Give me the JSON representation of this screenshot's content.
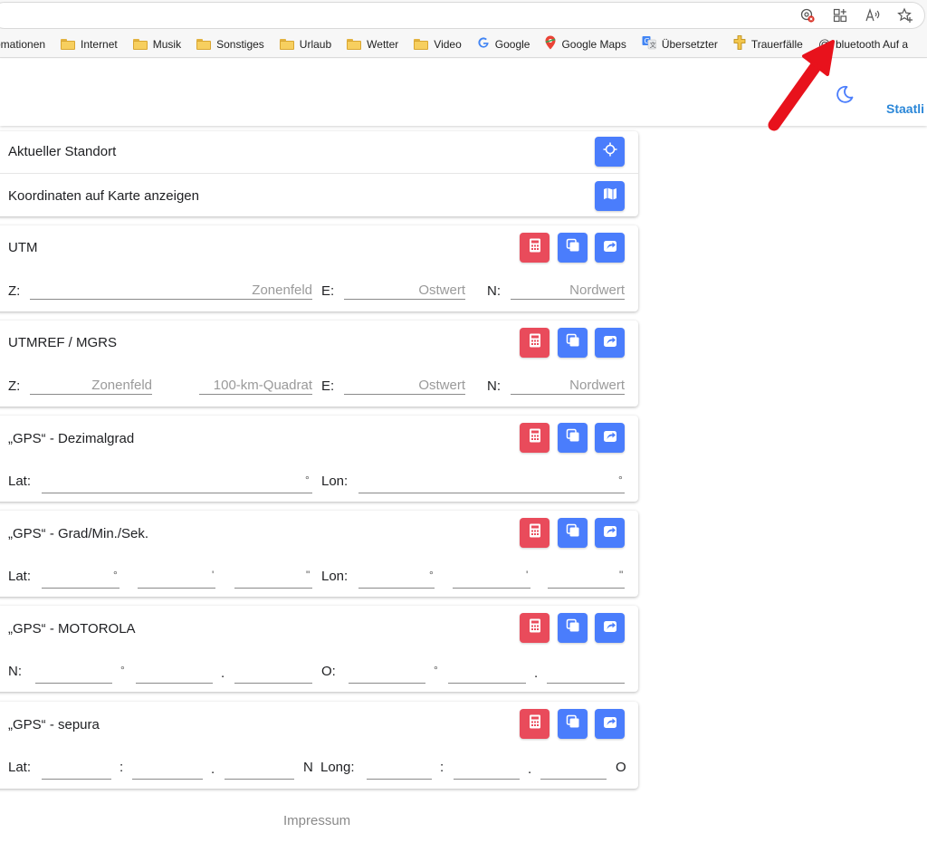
{
  "bookmarks": [
    {
      "label": "omationen",
      "icon": "folder-icon"
    },
    {
      "label": "Internet",
      "icon": "folder-icon"
    },
    {
      "label": "Musik",
      "icon": "folder-icon"
    },
    {
      "label": "Sonstiges",
      "icon": "folder-icon"
    },
    {
      "label": "Urlaub",
      "icon": "folder-icon"
    },
    {
      "label": "Wetter",
      "icon": "folder-icon"
    },
    {
      "label": "Video",
      "icon": "folder-icon"
    },
    {
      "label": "Google",
      "icon": "google-icon"
    },
    {
      "label": "Google Maps",
      "icon": "maps-pin-icon"
    },
    {
      "label": "Übersetzter",
      "icon": "translate-icon"
    },
    {
      "label": "Trauerfälle",
      "icon": "cross-icon"
    },
    {
      "label": "bluetooth Auf a",
      "icon": "at-icon"
    }
  ],
  "header": {
    "link_label": "Staatli"
  },
  "location_card": {
    "current_location_label": "Aktueller Standort",
    "show_on_map_label": "Koordinaten auf Karte anzeigen"
  },
  "utm": {
    "title": "UTM",
    "z_label": "Z:",
    "z_placeholder": "Zonenfeld",
    "e_label": "E:",
    "e_placeholder": "Ostwert",
    "n_label": "N:",
    "n_placeholder": "Nordwert"
  },
  "mgrs": {
    "title": "UTMREF / MGRS",
    "z_label": "Z:",
    "z_placeholder": "Zonenfeld",
    "square_placeholder": "100-km-Quadrat",
    "e_label": "E:",
    "e_placeholder": "Ostwert",
    "n_label": "N:",
    "n_placeholder": "Nordwert"
  },
  "gps_decimal": {
    "title": "„GPS“ - Dezimalgrad",
    "lat_label": "Lat:",
    "lon_label": "Lon:",
    "degree_symbol": "°"
  },
  "gps_dms": {
    "title": "„GPS“ - Grad/Min./Sek.",
    "lat_label": "Lat:",
    "lon_label": "Lon:",
    "deg": "°",
    "min": "'",
    "sec": "\""
  },
  "gps_motorola": {
    "title": "„GPS“ - MOTOROLA",
    "n_label": "N:",
    "o_label": "O:",
    "deg": "°",
    "dot": "."
  },
  "gps_sepura": {
    "title": "„GPS“ - sepura",
    "lat_label": "Lat:",
    "long_label": "Long:",
    "colon": ":",
    "dot": ".",
    "n_suffix": "N",
    "o_suffix": "O"
  },
  "footer": {
    "impressum": "Impressum"
  },
  "colors": {
    "primary_button": "#4a7dfc",
    "calculator_button": "#e94b5b",
    "link": "#2b87d8",
    "annotation_arrow": "#e8121c"
  }
}
